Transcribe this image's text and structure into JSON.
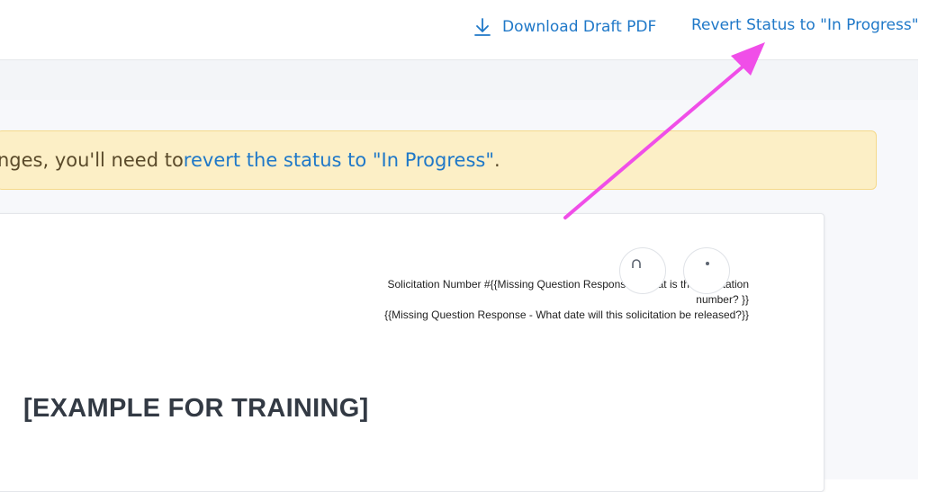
{
  "header": {
    "download_label": "Download Draft PDF",
    "revert_label": "Revert Status to \"In Progress\""
  },
  "alert": {
    "text_before": "nges, you'll need to ",
    "link_text": "revert the status to \"In Progress\"",
    "text_after": "."
  },
  "document": {
    "header_line1": "Solicitation Number #{{Missing Question Response - What is the solicitation",
    "header_line2": "number? }}",
    "header_line3": "{{Missing Question Response - What date will this solicitation be released?}}",
    "title": "[EXAMPLE FOR TRAINING]"
  },
  "colors": {
    "link": "#1f78c8",
    "alert_bg": "#fcefc6",
    "annotation_arrow": "#f04ee8"
  }
}
